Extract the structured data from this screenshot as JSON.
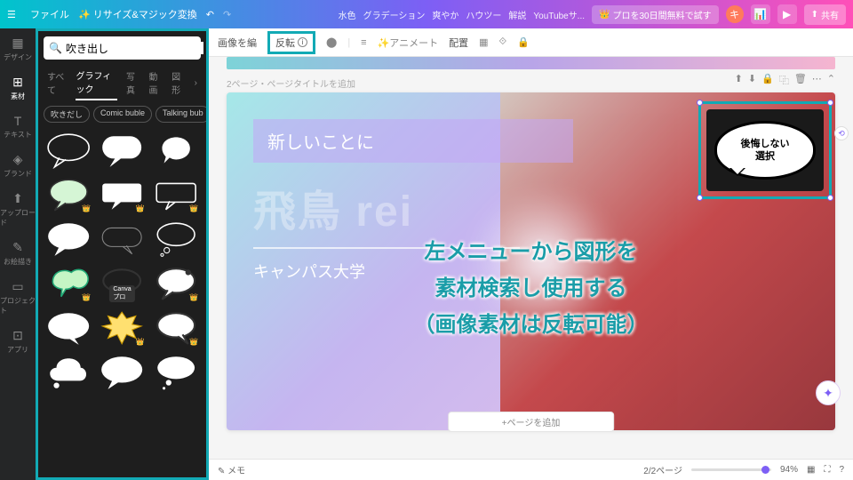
{
  "topbar": {
    "file": "ファイル",
    "resize": "リサイズ&マジック変換",
    "tags": [
      "水色",
      "グラデーション",
      "爽やか",
      "ハウツー",
      "解説",
      "YouTubeサ..."
    ],
    "pro": "プロを30日間無料で試す",
    "avatar": "キ",
    "share": "共有"
  },
  "leftbar": {
    "items": [
      {
        "icon": "▦",
        "label": "デザイン"
      },
      {
        "icon": "⊞",
        "label": "素材"
      },
      {
        "icon": "T",
        "label": "テキスト"
      },
      {
        "icon": "◈",
        "label": "ブランド"
      },
      {
        "icon": "⬆",
        "label": "アップロード"
      },
      {
        "icon": "✎",
        "label": "お絵描き"
      },
      {
        "icon": "▭",
        "label": "プロジェクト"
      },
      {
        "icon": "⊡",
        "label": "アプリ"
      }
    ]
  },
  "panel": {
    "search_placeholder": "吹き出し",
    "tabs": [
      "すべて",
      "グラフィック",
      "写真",
      "動画",
      "図形"
    ],
    "active_tab": 1,
    "chips": [
      "吹きだし",
      "Comic buble",
      "Talking bub"
    ],
    "pro_badge": "Canvaプロ"
  },
  "toolbar": {
    "edit_image": "画像を編",
    "flip": "反転",
    "animate": "アニメート",
    "position": "配置"
  },
  "canvas": {
    "page_header": "2ページ・ページタイトルを追加",
    "box1": "新しいことに",
    "big": "飛鳥 rei",
    "sub": "キャンパス大学",
    "add_page": "+ページを追加",
    "speech_line1": "後悔しない",
    "speech_line2": "選択"
  },
  "annotation": {
    "l1": "左メニューから図形を",
    "l2": "素材検索し使用する",
    "l3": "（画像素材は反転可能）"
  },
  "bottom": {
    "memo": "メモ",
    "pages": "2/2ページ",
    "zoom": "94%"
  }
}
